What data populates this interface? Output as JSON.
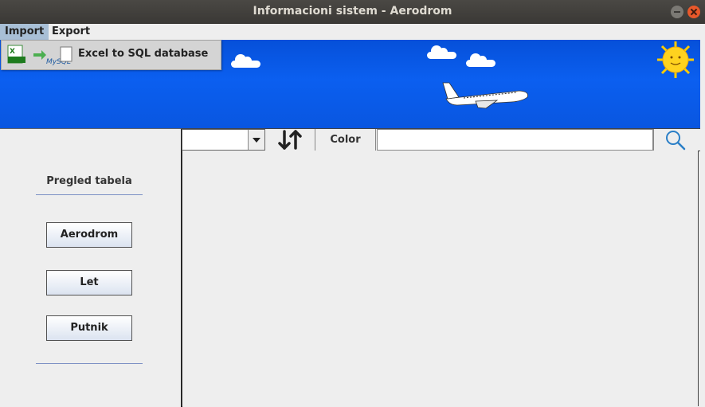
{
  "window": {
    "title": "Informacioni sistem - Aerodrom"
  },
  "menubar": {
    "items": [
      {
        "label": "Import",
        "active": true
      },
      {
        "label": "Export",
        "active": false
      }
    ]
  },
  "import_menu": {
    "items": [
      {
        "label": "Excel to SQL database",
        "icon": "excel-to-mysql-icon"
      }
    ]
  },
  "banner": {
    "icons": [
      "cloud-icon",
      "airplane-icon",
      "sun-icon"
    ]
  },
  "sidebar": {
    "title": "Pregled tabela",
    "buttons": [
      {
        "label": "Aerodrom"
      },
      {
        "label": "Let"
      },
      {
        "label": "Putnik"
      }
    ]
  },
  "toolbar": {
    "combo_value": "",
    "sort_icon": "sort-arrows-icon",
    "color_label": "Color",
    "search_value": "",
    "search_icon": "magnifier-icon"
  },
  "colors": {
    "banner_blue": "#0a5be8",
    "menu_highlight": "#a8bfd6",
    "title_bar": "#3c3b37",
    "close_button": "#e9582a"
  }
}
